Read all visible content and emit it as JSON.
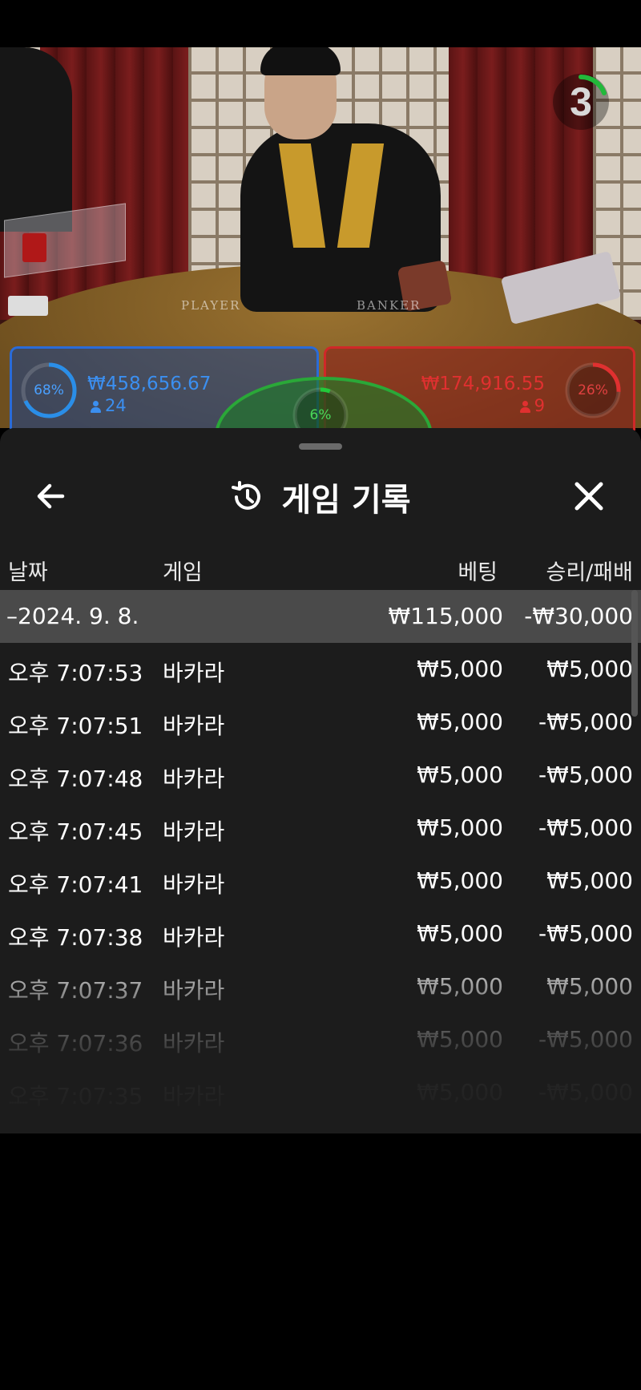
{
  "video": {
    "timer": "3",
    "table_labels": {
      "player": "PLAYER",
      "banker": "BANKER"
    },
    "player": {
      "percent": "68%",
      "amount": "₩458,656.67",
      "players": "24",
      "color": "#2a6bd8"
    },
    "banker": {
      "percent": "26%",
      "amount": "₩174,916.55",
      "players": "9",
      "color": "#d02828"
    },
    "tie": {
      "percent": "6%",
      "color": "#2aa838"
    }
  },
  "history": {
    "title": "게임 기록",
    "icons": {
      "back": "arrow-left-icon",
      "history": "history-icon",
      "close": "close-icon"
    },
    "columns": {
      "date": "날짜",
      "game": "게임",
      "bet": "베팅",
      "result": "승리/패배"
    },
    "date_group": {
      "date": "–2024. 9. 8.",
      "bet_total": "₩115,000",
      "result_total": "-₩30,000"
    },
    "rows": [
      {
        "time": "오후 7:07:53",
        "game": "바카라",
        "bet": "₩5,000",
        "result": "₩5,000"
      },
      {
        "time": "오후 7:07:51",
        "game": "바카라",
        "bet": "₩5,000",
        "result": "-₩5,000"
      },
      {
        "time": "오후 7:07:48",
        "game": "바카라",
        "bet": "₩5,000",
        "result": "-₩5,000"
      },
      {
        "time": "오후 7:07:45",
        "game": "바카라",
        "bet": "₩5,000",
        "result": "-₩5,000"
      },
      {
        "time": "오후 7:07:41",
        "game": "바카라",
        "bet": "₩5,000",
        "result": "₩5,000"
      },
      {
        "time": "오후 7:07:38",
        "game": "바카라",
        "bet": "₩5,000",
        "result": "-₩5,000"
      },
      {
        "time": "오후 7:07:37",
        "game": "바카라",
        "bet": "₩5,000",
        "result": "₩5,000"
      },
      {
        "time": "오후 7:07:36",
        "game": "바카라",
        "bet": "₩5,000",
        "result": "-₩5,000"
      },
      {
        "time": "오후 7:07:35",
        "game": "바카라",
        "bet": "₩5,000",
        "result": "-₩5,000"
      }
    ]
  }
}
